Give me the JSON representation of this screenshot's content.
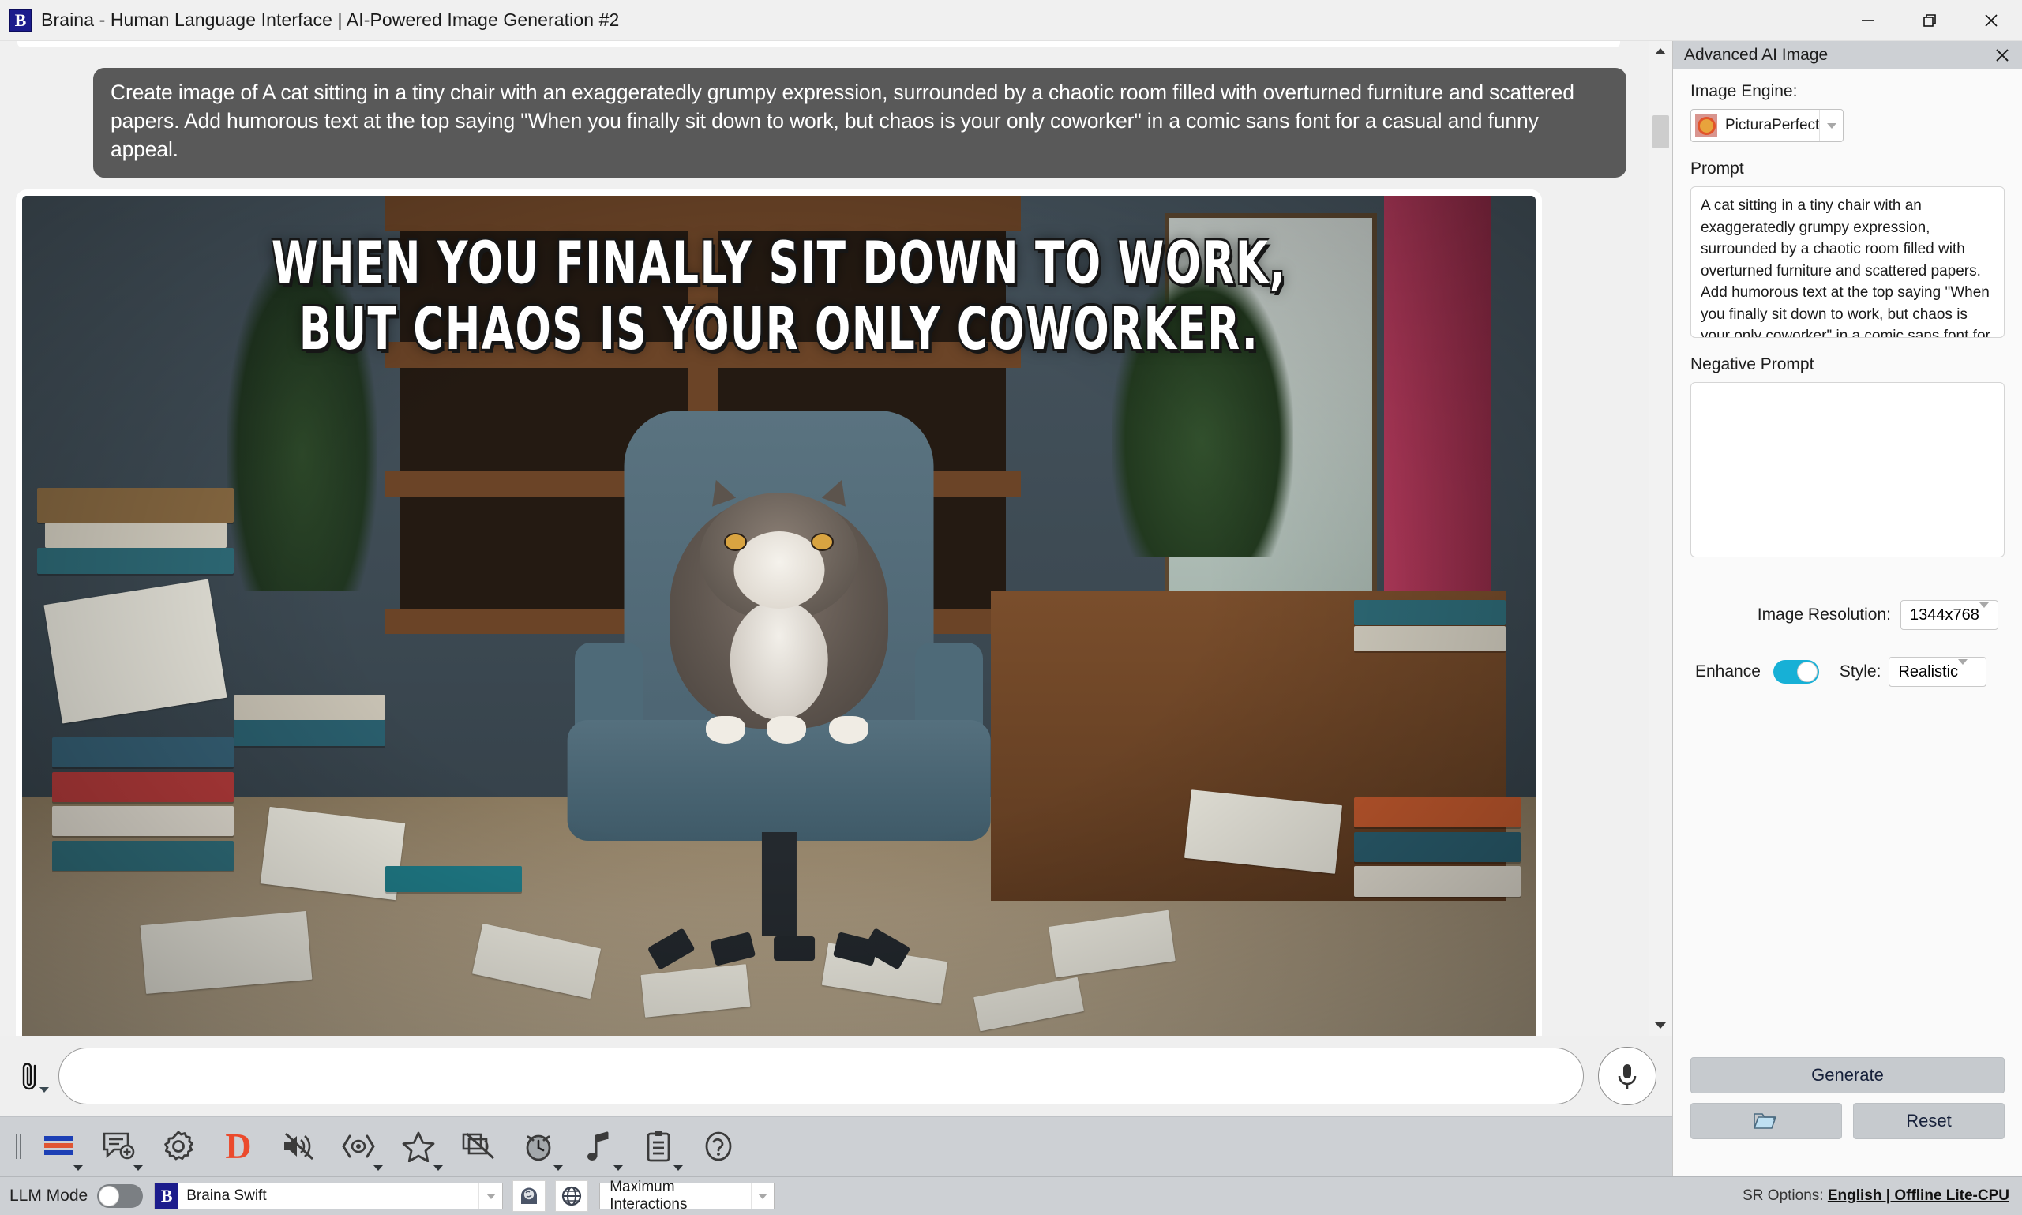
{
  "window": {
    "title": "Braina - Human Language Interface | AI-Powered Image Generation #2",
    "app_badge": "B",
    "minimize_label": "Minimize",
    "maximize_label": "Restore",
    "close_label": "Close"
  },
  "chat": {
    "user_message": "Create image of A cat sitting in a tiny chair with an exaggeratedly grumpy expression, surrounded by a chaotic room filled with overturned furniture and scattered papers. Add humorous text at the top saying \"When you finally sit down to work, but chaos is your only coworker\" in a comic sans font for a casual and funny appeal.",
    "generated_image": {
      "alt": "Grumpy cat sitting in a blue office chair in a chaotic room full of scattered books and papers",
      "overlay_text": "WHEN YOU FINALLY SIT DOWN TO WORK,\nBUT CHAOS IS YOUR ONLY COWORKER."
    },
    "input_placeholder": "",
    "input_value": "",
    "attach_icon": "paperclip-icon",
    "mic_icon": "microphone-icon"
  },
  "toolbar": {
    "items": [
      {
        "name": "translate-icon",
        "glyph": "stripes",
        "caret": true
      },
      {
        "name": "new-chat-icon",
        "glyph": "chat-plus",
        "caret": true
      },
      {
        "name": "settings-gear-icon",
        "glyph": "gear",
        "caret": false
      },
      {
        "name": "dictation-icon",
        "glyph": "D",
        "caret": false
      },
      {
        "name": "mute-speaker-icon",
        "glyph": "mute",
        "caret": false
      },
      {
        "name": "read-aloud-icon",
        "glyph": "eye",
        "caret": true
      },
      {
        "name": "favorites-star-icon",
        "glyph": "star",
        "caret": true
      },
      {
        "name": "screen-reader-off-icon",
        "glyph": "screen-mute",
        "caret": false
      },
      {
        "name": "alarm-clock-icon",
        "glyph": "clock",
        "caret": true
      },
      {
        "name": "music-note-icon",
        "glyph": "music",
        "caret": true
      },
      {
        "name": "clipboard-icon",
        "glyph": "clipboard",
        "caret": true
      },
      {
        "name": "help-icon",
        "glyph": "question",
        "caret": false
      }
    ]
  },
  "statusbar": {
    "llm_mode_label": "LLM Mode",
    "llm_mode_on": false,
    "model_badge": "B",
    "model_name": "Braina Swift",
    "brain_icon": "brain-head-icon",
    "globe_icon": "globe-icon",
    "interactions_value": "Maximum Interactions",
    "sr_options_prefix": "SR Options: ",
    "sr_options_value": "English | Offline Lite-CPU"
  },
  "panel": {
    "title": "Advanced AI Image",
    "close_icon": "close-icon",
    "image_engine_label": "Image Engine:",
    "image_engine_value": "PicturaPerfect",
    "image_engine_swatch": "#e2542a",
    "prompt_label": "Prompt",
    "prompt_value": "A cat sitting in a tiny chair with an exaggeratedly grumpy expression, surrounded by a chaotic room filled with overturned furniture and scattered papers. Add humorous text at the top saying \"When you finally sit down to work, but chaos is your only coworker\" in a comic sans font for a casual and funny appeal.",
    "negative_prompt_label": "Negative Prompt",
    "negative_prompt_value": "",
    "resolution_label": "Image Resolution:",
    "resolution_value": "1344x768",
    "enhance_label": "Enhance",
    "enhance_on": true,
    "enhance_color": "#1cb5dd",
    "style_label": "Style:",
    "style_value": "Realistic",
    "generate_label": "Generate",
    "open_folder_icon": "folder-icon",
    "open_folder_label": "",
    "reset_label": "Reset"
  }
}
